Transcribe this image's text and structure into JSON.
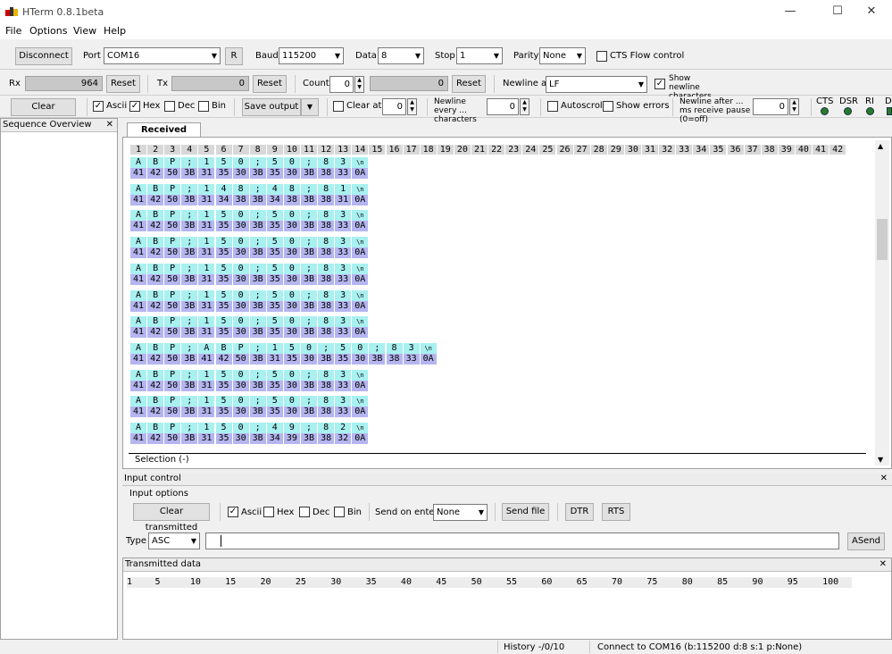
{
  "window": {
    "title": "HTerm 0.8.1beta"
  },
  "menu": [
    "File",
    "Options",
    "View",
    "Help"
  ],
  "toolbar1": {
    "disconnect": "Disconnect",
    "port_label": "Port",
    "port": "COM16",
    "r_button": "R",
    "baud_label": "Baud",
    "baud": "115200",
    "data_label": "Data",
    "data": "8",
    "stop_label": "Stop",
    "stop": "1",
    "parity_label": "Parity",
    "parity": "None",
    "cts_flow": "CTS Flow control"
  },
  "toolbar2": {
    "rx_label": "Rx",
    "rx_value": "964",
    "rx_reset": "Reset",
    "tx_label": "Tx",
    "tx_value": "0",
    "tx_reset": "Reset",
    "count_label": "Count",
    "count_value": "0",
    "count_display": "0",
    "count_reset": "Reset",
    "newline_label": "Newline at",
    "newline_value": "LF",
    "show_newline": "Show newline characters"
  },
  "toolbar3": {
    "clear_received": "Clear received",
    "ascii": "Ascii",
    "hex": "Hex",
    "dec": "Dec",
    "bin": "Bin",
    "save_output": "Save output",
    "clear_at": "Clear at",
    "clear_at_value": "0",
    "newline_every": "Newline every ... characters",
    "newline_every_value": "0",
    "autoscroll": "Autoscroll",
    "show_errors": "Show errors",
    "newline_after": "Newline after ... ms receive pause (0=off)",
    "newline_after_value": "0",
    "signals": [
      "CTS",
      "DSR",
      "RI",
      "DCD"
    ]
  },
  "sequence": {
    "title": "Sequence Overview",
    "close": "✕"
  },
  "received": {
    "tab": "Received Data",
    "columns": [
      "1",
      "2",
      "3",
      "4",
      "5",
      "6",
      "7",
      "8",
      "9",
      "10",
      "11",
      "12",
      "13",
      "14",
      "15",
      "16",
      "17",
      "18",
      "19",
      "20",
      "21",
      "22",
      "23",
      "24",
      "25",
      "26",
      "27",
      "28",
      "29",
      "30",
      "31",
      "32",
      "33",
      "34",
      "35",
      "36",
      "37",
      "38",
      "39",
      "40",
      "41",
      "42"
    ],
    "rows": [
      {
        "ascii": [
          "A",
          "B",
          "P",
          ";",
          "1",
          "5",
          "0",
          ";",
          "5",
          "0",
          ";",
          "8",
          "3",
          "\\n"
        ],
        "hex": [
          "41",
          "42",
          "50",
          "3B",
          "31",
          "35",
          "30",
          "3B",
          "35",
          "30",
          "3B",
          "38",
          "33",
          "0A"
        ]
      },
      {
        "ascii": [
          "A",
          "B",
          "P",
          ";",
          "1",
          "4",
          "8",
          ";",
          "4",
          "8",
          ";",
          "8",
          "1",
          "\\n"
        ],
        "hex": [
          "41",
          "42",
          "50",
          "3B",
          "31",
          "34",
          "38",
          "3B",
          "34",
          "38",
          "3B",
          "38",
          "31",
          "0A"
        ]
      },
      {
        "ascii": [
          "A",
          "B",
          "P",
          ";",
          "1",
          "5",
          "0",
          ";",
          "5",
          "0",
          ";",
          "8",
          "3",
          "\\n"
        ],
        "hex": [
          "41",
          "42",
          "50",
          "3B",
          "31",
          "35",
          "30",
          "3B",
          "35",
          "30",
          "3B",
          "38",
          "33",
          "0A"
        ]
      },
      {
        "ascii": [
          "A",
          "B",
          "P",
          ";",
          "1",
          "5",
          "0",
          ";",
          "5",
          "0",
          ";",
          "8",
          "3",
          "\\n"
        ],
        "hex": [
          "41",
          "42",
          "50",
          "3B",
          "31",
          "35",
          "30",
          "3B",
          "35",
          "30",
          "3B",
          "38",
          "33",
          "0A"
        ]
      },
      {
        "ascii": [
          "A",
          "B",
          "P",
          ";",
          "1",
          "5",
          "0",
          ";",
          "5",
          "0",
          ";",
          "8",
          "3",
          "\\n"
        ],
        "hex": [
          "41",
          "42",
          "50",
          "3B",
          "31",
          "35",
          "30",
          "3B",
          "35",
          "30",
          "3B",
          "38",
          "33",
          "0A"
        ]
      },
      {
        "ascii": [
          "A",
          "B",
          "P",
          ";",
          "1",
          "5",
          "0",
          ";",
          "5",
          "0",
          ";",
          "8",
          "3",
          "\\n"
        ],
        "hex": [
          "41",
          "42",
          "50",
          "3B",
          "31",
          "35",
          "30",
          "3B",
          "35",
          "30",
          "3B",
          "38",
          "33",
          "0A"
        ]
      },
      {
        "ascii": [
          "A",
          "B",
          "P",
          ";",
          "1",
          "5",
          "0",
          ";",
          "5",
          "0",
          ";",
          "8",
          "3",
          "\\n"
        ],
        "hex": [
          "41",
          "42",
          "50",
          "3B",
          "31",
          "35",
          "30",
          "3B",
          "35",
          "30",
          "3B",
          "38",
          "33",
          "0A"
        ]
      },
      {
        "ascii": [
          "A",
          "B",
          "P",
          ";",
          "A",
          "B",
          "P",
          ";",
          "1",
          "5",
          "0",
          ";",
          "5",
          "0",
          ";",
          "8",
          "3",
          "\\n"
        ],
        "hex": [
          "41",
          "42",
          "50",
          "3B",
          "41",
          "42",
          "50",
          "3B",
          "31",
          "35",
          "30",
          "3B",
          "35",
          "30",
          "3B",
          "38",
          "33",
          "0A"
        ]
      },
      {
        "ascii": [
          "A",
          "B",
          "P",
          ";",
          "1",
          "5",
          "0",
          ";",
          "5",
          "0",
          ";",
          "8",
          "3",
          "\\n"
        ],
        "hex": [
          "41",
          "42",
          "50",
          "3B",
          "31",
          "35",
          "30",
          "3B",
          "35",
          "30",
          "3B",
          "38",
          "33",
          "0A"
        ]
      },
      {
        "ascii": [
          "A",
          "B",
          "P",
          ";",
          "1",
          "5",
          "0",
          ";",
          "5",
          "0",
          ";",
          "8",
          "3",
          "\\n"
        ],
        "hex": [
          "41",
          "42",
          "50",
          "3B",
          "31",
          "35",
          "30",
          "3B",
          "35",
          "30",
          "3B",
          "38",
          "33",
          "0A"
        ]
      },
      {
        "ascii": [
          "A",
          "B",
          "P",
          ";",
          "1",
          "5",
          "0",
          ";",
          "4",
          "9",
          ";",
          "8",
          "2",
          "\\n"
        ],
        "hex": [
          "41",
          "42",
          "50",
          "3B",
          "31",
          "35",
          "30",
          "3B",
          "34",
          "39",
          "3B",
          "38",
          "32",
          "0A"
        ]
      }
    ],
    "selection": "Selection (-)"
  },
  "input_control": {
    "title": "Input control",
    "close": "✕",
    "options_label": "Input options",
    "clear_transmitted": "Clear transmitted",
    "ascii": "Ascii",
    "hex": "Hex",
    "dec": "Dec",
    "bin": "Bin",
    "send_on_enter": "Send on enter",
    "send_on_enter_value": "None",
    "send_file": "Send file",
    "dtr": "DTR",
    "rts": "RTS",
    "type_label": "Type",
    "type_value": "ASC",
    "input_value": "",
    "asend": "ASend"
  },
  "transmitted": {
    "title": "Transmitted data",
    "close": "✕",
    "ruler": [
      "1",
      "5",
      "10",
      "15",
      "20",
      "25",
      "30",
      "35",
      "40",
      "45",
      "50",
      "55",
      "60",
      "65",
      "70",
      "75",
      "80",
      "85",
      "90",
      "95",
      "100"
    ]
  },
  "status": {
    "history": "History -/0/10",
    "connection": "Connect to COM16 (b:115200 d:8 s:1 p:None)"
  },
  "colors": {
    "ascii_bg": "#a9f0f0",
    "hex_bg": "#b5b5f0",
    "led": "#2a7a2a"
  }
}
